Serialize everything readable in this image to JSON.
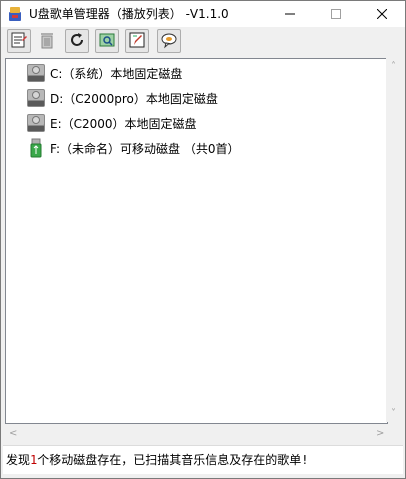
{
  "window": {
    "title": "U盘歌单管理器（播放列表） -V1.1.0"
  },
  "toolbar": {
    "buttons": [
      {
        "name": "playlist-edit-icon"
      },
      {
        "name": "delete-icon"
      },
      {
        "name": "refresh-icon"
      },
      {
        "name": "scan-icon"
      },
      {
        "name": "edit-text-icon"
      },
      {
        "name": "about-icon"
      }
    ]
  },
  "drives": [
    {
      "label": "C:（系统）本地固定磁盘",
      "icon": "hard-drive-icon"
    },
    {
      "label": "D:（C2000pro）本地固定磁盘",
      "icon": "hard-drive-icon"
    },
    {
      "label": "E:（C2000）本地固定磁盘",
      "icon": "hard-drive-icon"
    },
    {
      "label": "F:（未命名）可移动磁盘 （共0首）",
      "icon": "usb-drive-icon"
    }
  ],
  "status": {
    "prefix": "发现",
    "count": "1",
    "suffix": "个移动磁盘存在，已扫描其音乐信息及存在的歌单!"
  },
  "colors": {
    "status_count": "#c00000"
  }
}
